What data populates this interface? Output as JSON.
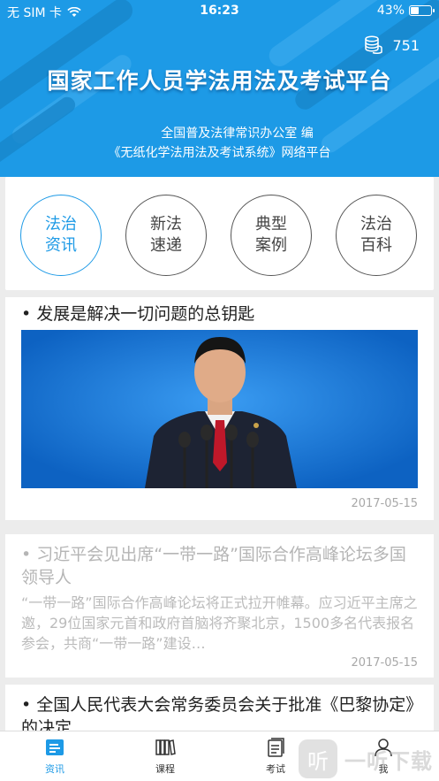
{
  "status_bar": {
    "carrier": "无 SIM 卡",
    "time": "16:23",
    "battery": "43%",
    "battery_level": 0.43
  },
  "header": {
    "coin_count": "751",
    "title": "国家工作人员学法用法及考试平台",
    "subtitle_line1": "全国普及法律常识办公室 编",
    "subtitle_line2": "《无纸化学法用法及考试系统》网络平台"
  },
  "categories": [
    {
      "line1": "法治",
      "line2": "资讯",
      "active": true
    },
    {
      "line1": "新法",
      "line2": "速递",
      "active": false
    },
    {
      "line1": "典型",
      "line2": "案例",
      "active": false
    },
    {
      "line1": "法治",
      "line2": "百科",
      "active": false
    }
  ],
  "articles": [
    {
      "title": "• 发展是解决一切问题的总钥匙",
      "date": "2017-05-15"
    },
    {
      "title": "• 习近平会见出席“一带一路”国际合作高峰论坛多国领导人",
      "summary": "“一带一路”国际合作高峰论坛将正式拉开帷幕。应习近平主席之邀，29位国家元首和政府首脑将齐聚北京，1500多名代表报名参会，共商“一带一路”建设…",
      "date": "2017-05-15"
    },
    {
      "title": "• 全国人民代表大会常务委员会关于批准《巴黎协定》的决定"
    }
  ],
  "tabbar": [
    {
      "label": "资讯",
      "icon": "news-icon",
      "active": true
    },
    {
      "label": "课程",
      "icon": "books-icon",
      "active": false
    },
    {
      "label": "考试",
      "icon": "exam-icon",
      "active": false
    },
    {
      "label": "我",
      "icon": "person-icon",
      "active": false
    }
  ],
  "watermark": {
    "text": "一听下载",
    "logo_char": "听"
  },
  "colors": {
    "accent": "#1d9ae6",
    "header_bg": "#1d9ae6"
  }
}
